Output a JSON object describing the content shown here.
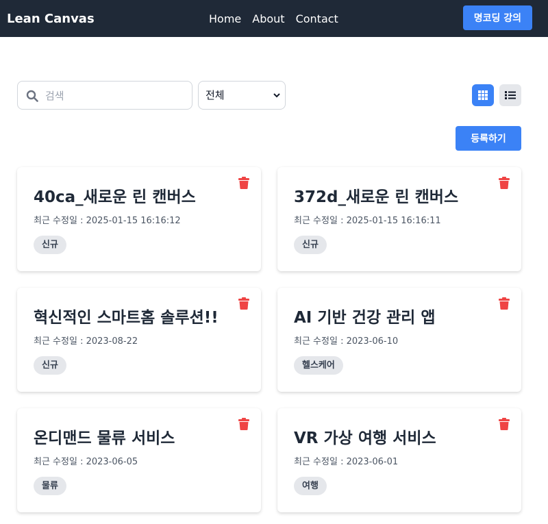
{
  "header": {
    "brand": "Lean Canvas",
    "nav": [
      "Home",
      "About",
      "Contact"
    ],
    "course_button": "명코딩 강의"
  },
  "toolbar": {
    "search_placeholder": "검색",
    "filter_selected": "전체",
    "register_button": "등록하기"
  },
  "icons": {
    "search": "search-icon",
    "grid_view": "grid-icon",
    "list_view": "list-icon",
    "delete": "trash-icon"
  },
  "colors": {
    "header_bg": "#1f2937",
    "accent": "#3b82f6",
    "delete": "#ef4444",
    "tag_bg": "#e5e7eb"
  },
  "cards": [
    {
      "title": "40ca_새로운 린 캔버스",
      "date": "최근 수정일 : 2025-01-15 16:16:12",
      "tag": "신규"
    },
    {
      "title": "372d_새로운 린 캔버스",
      "date": "최근 수정일 : 2025-01-15 16:16:11",
      "tag": "신규"
    },
    {
      "title": "혁신적인 스마트홈 솔루션!!",
      "date": "최근 수정일 : 2023-08-22",
      "tag": "신규"
    },
    {
      "title": "AI 기반 건강 관리 앱",
      "date": "최근 수정일 : 2023-06-10",
      "tag": "헬스케어"
    },
    {
      "title": "온디맨드 물류 서비스",
      "date": "최근 수정일 : 2023-06-05",
      "tag": "물류"
    },
    {
      "title": "VR 가상 여행 서비스",
      "date": "최근 수정일 : 2023-06-01",
      "tag": "여행"
    }
  ]
}
